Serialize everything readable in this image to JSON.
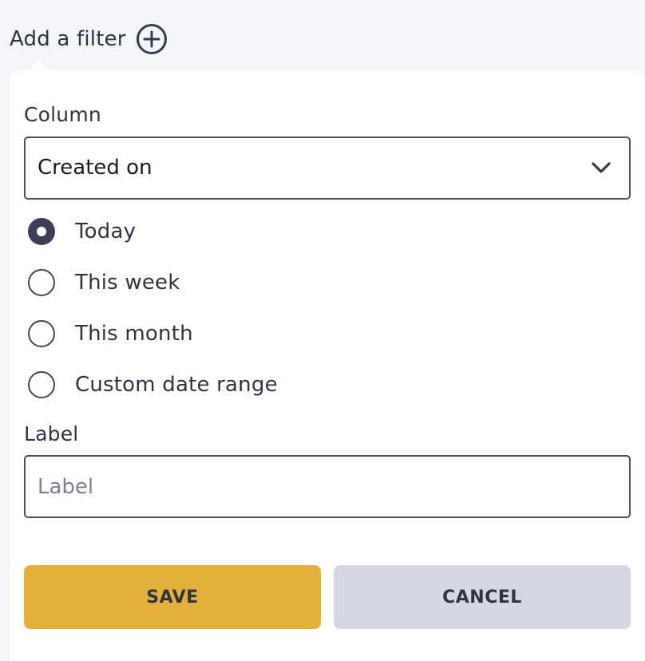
{
  "header": {
    "add_filter_label": "Add a filter",
    "add_icon": "plus-circle-icon"
  },
  "filter": {
    "column_label": "Column",
    "column_value": "Created on",
    "dropdown_icon": "chevron-down-icon",
    "date_options": [
      {
        "label": "Today",
        "checked": true
      },
      {
        "label": "This week",
        "checked": false
      },
      {
        "label": "This month",
        "checked": false
      },
      {
        "label": "Custom date range",
        "checked": false
      }
    ],
    "label_field_label": "Label",
    "label_placeholder": "Label",
    "label_value": ""
  },
  "actions": {
    "save_label": "SAVE",
    "cancel_label": "CANCEL"
  },
  "colors": {
    "background": "#f4f5f8",
    "panel": "#ffffff",
    "text": "#2f3342",
    "save_button": "#e4b03c",
    "cancel_button": "#d5d7e2",
    "radio_checked": "#3a3f55",
    "border": "#4a4f62"
  }
}
